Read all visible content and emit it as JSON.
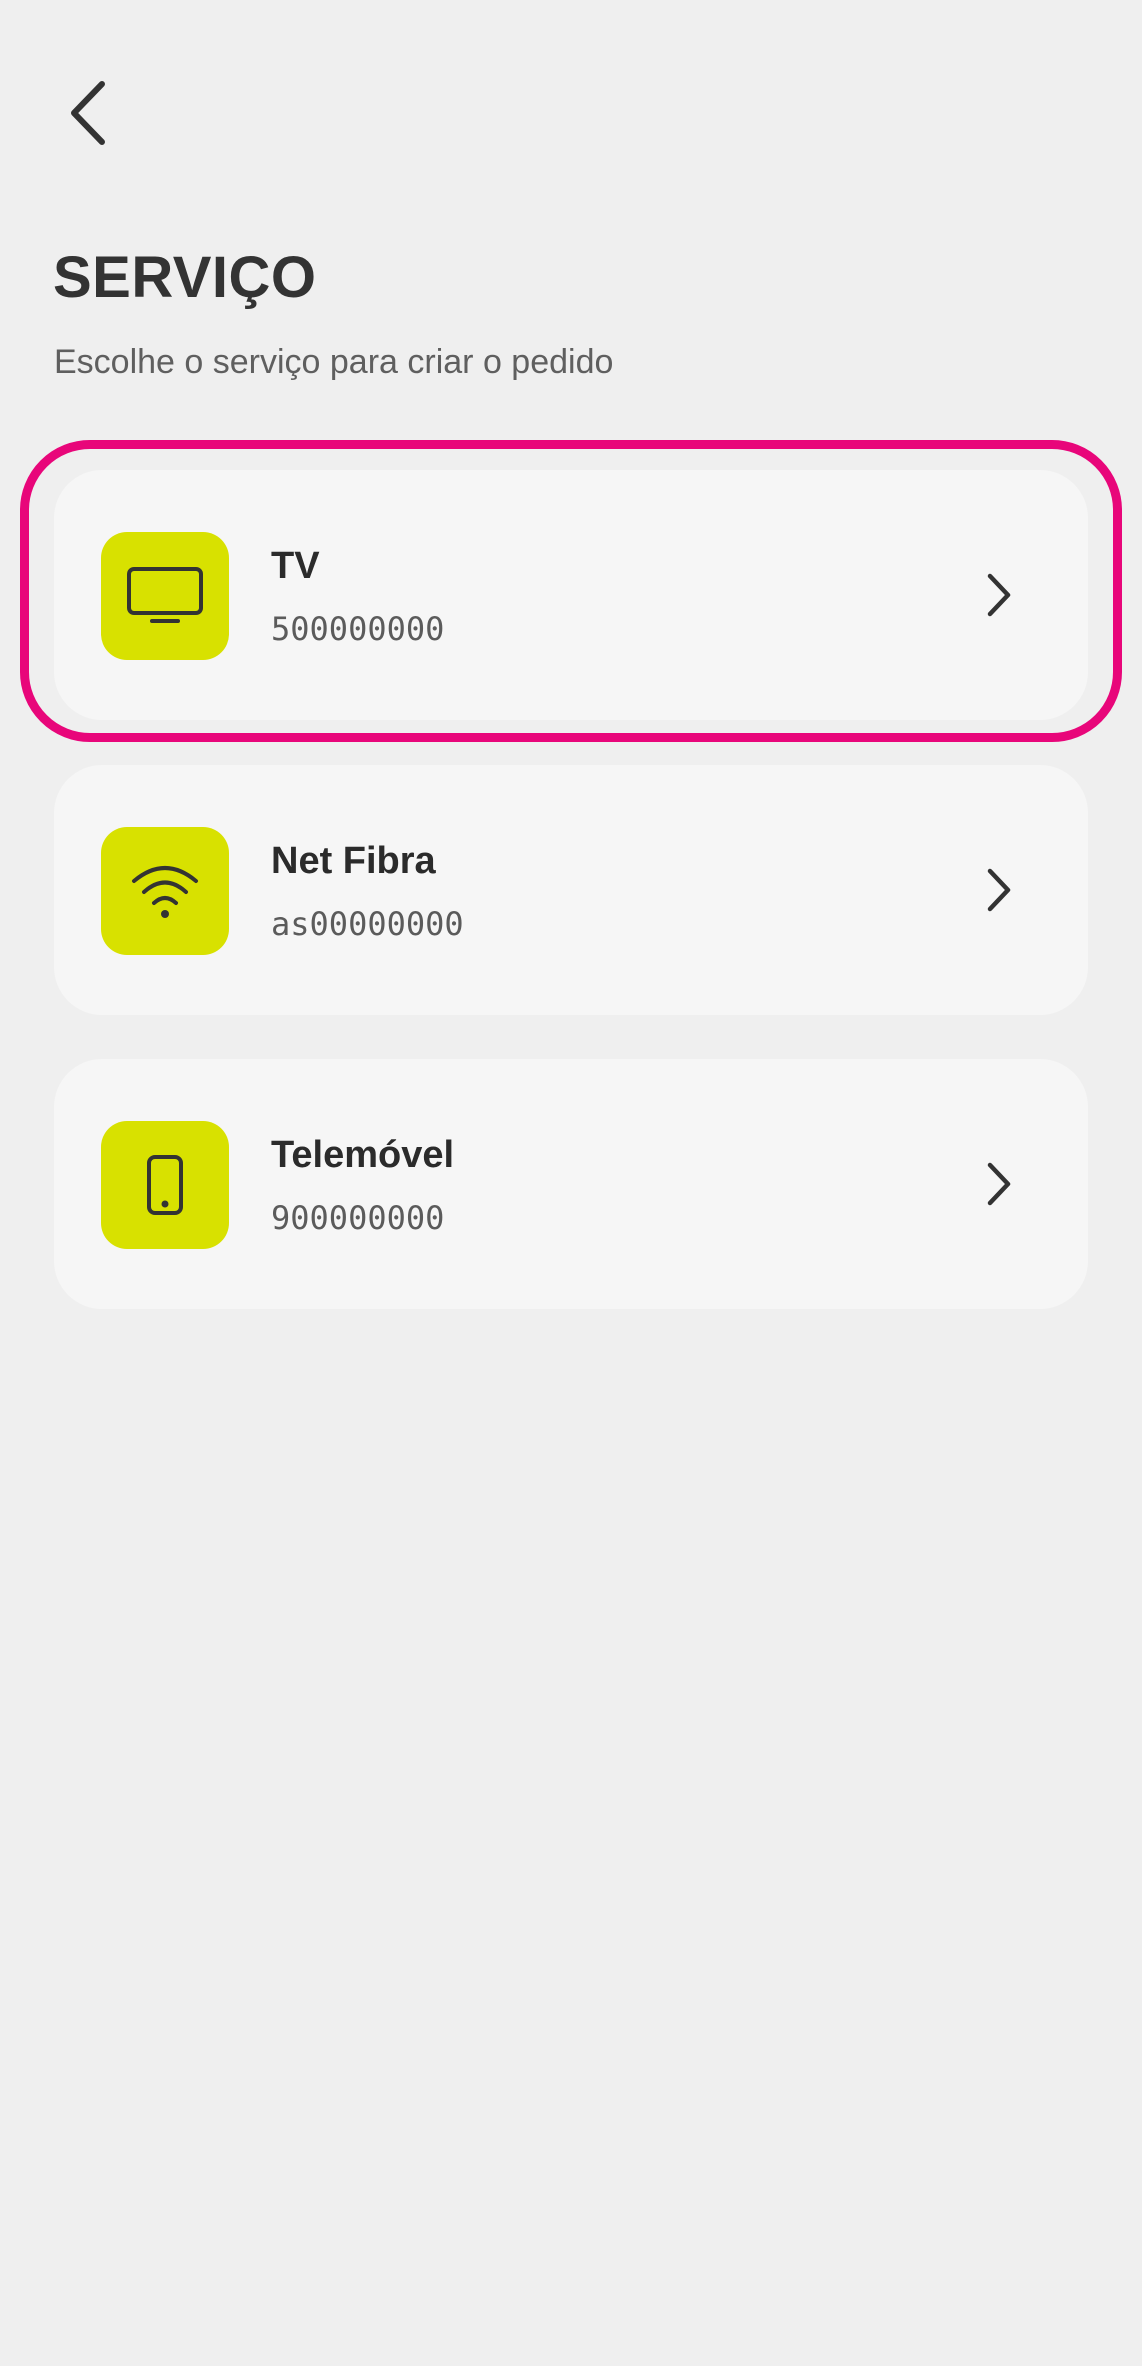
{
  "header": {
    "back_icon": "chevron-left-icon",
    "title": "SERVIÇO",
    "subtitle": "Escolhe o serviço para criar o pedido"
  },
  "services": [
    {
      "name": "TV",
      "number": "500000000",
      "icon": "tv-icon",
      "highlighted": true
    },
    {
      "name": "Net Fibra",
      "number": "as00000000",
      "icon": "wifi-icon",
      "highlighted": false
    },
    {
      "name": "Telemóvel",
      "number": "900000000",
      "icon": "smartphone-icon",
      "highlighted": false
    }
  ],
  "colors": {
    "background": "#efefef",
    "card": "#f6f6f6",
    "icon_accent": "#d8e100",
    "highlight": "#e8067a",
    "text_primary": "#2b2b2b",
    "text_secondary": "#5b5b5b"
  }
}
